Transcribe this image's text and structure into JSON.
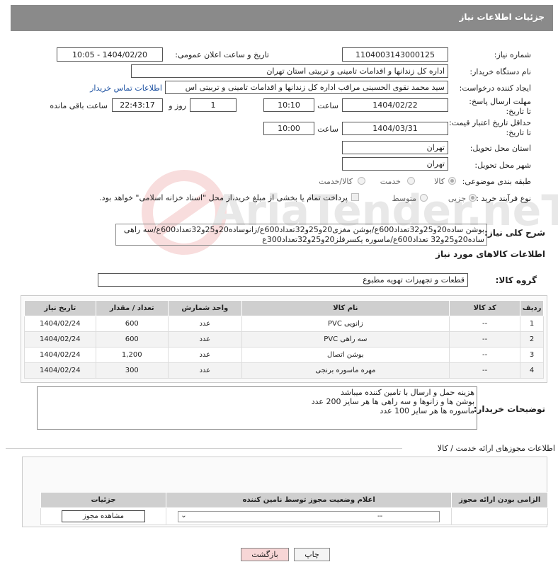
{
  "header": {
    "title": "جزئیات اطلاعات نیاز"
  },
  "fields": {
    "need_number_label": "شماره نیاز:",
    "need_number": "1104003143000125",
    "announce_label": "تاریخ و ساعت اعلان عمومی:",
    "announce_value": "1404/02/20 - 10:05",
    "buyer_org_label": "نام دستگاه خریدار:",
    "buyer_org": "اداره کل زندانها و اقدامات تامینی و تربیتی استان تهران",
    "requester_label": "ایجاد کننده درخواست:",
    "requester": "سید محمد نقوی الحسینی مراقب  اداره کل زندانها و اقدامات تامینی و تربیتی اس",
    "contact_link": "اطلاعات تماس خریدار",
    "deadline_label": "مهلت ارسال پاسخ: تا تاریخ:",
    "deadline_date": "1404/02/22",
    "time_label": "ساعت",
    "deadline_time": "10:10",
    "days_value": "1",
    "days_label": "روز و",
    "remaining_time": "22:43:17",
    "remaining_label": "ساعت باقی مانده",
    "validity_label": "حداقل تاریخ اعتبار قیمت: تا تاریخ:",
    "validity_date": "1404/03/31",
    "validity_time": "10:00",
    "province_label": "استان محل تحویل:",
    "province": "تهران",
    "city_label": "شهر محل تحویل:",
    "city": "تهران",
    "category_label": "طبقه بندی موضوعی:",
    "cat_goods": "کالا",
    "cat_service": "خدمت",
    "cat_both": "کالا/خدمت",
    "process_label": "نوع فرآیند خرید :",
    "proc_partial": "جزیی",
    "proc_medium": "متوسط",
    "payment_note": "پرداخت تمام یا بخشی از مبلغ خرید،از محل \"اسناد خزانه اسلامی\" خواهد بود."
  },
  "description": {
    "label": "شرح کلی نیاز:",
    "text": "بوشن ساده20و25و32تعداد600ع/بوشن مغزی20و25و32تعداد600ع/زانوساده20و25و32تعداد600ع/سه راهی ساده20و25و32 تعداد600ع/ماسوره یکسرفلز20و25و32تعداد300ع"
  },
  "goods_section": {
    "title": "اطلاعات کالاهای مورد نیاز",
    "group_label": "گروه کالا:",
    "group_value": "قطعات و تجهیزات تهویه مطبوع"
  },
  "goods_table": {
    "headers": [
      "ردیف",
      "کد کالا",
      "نام کالا",
      "واحد شمارش",
      "تعداد / مقدار",
      "تاریخ نیاز"
    ],
    "rows": [
      [
        "1",
        "--",
        "زانویی PVC",
        "عدد",
        "600",
        "1404/02/24"
      ],
      [
        "2",
        "--",
        "سه راهی PVC",
        "عدد",
        "600",
        "1404/02/24"
      ],
      [
        "3",
        "--",
        "بوشن اتصال",
        "عدد",
        "1,200",
        "1404/02/24"
      ],
      [
        "4",
        "--",
        "مهره ماسوره برنجی",
        "عدد",
        "300",
        "1404/02/24"
      ]
    ]
  },
  "buyer_notes": {
    "label": "توضیحات خریدار:",
    "lines": [
      "هزینه حمل و ارسال با تامین کننده میباشد",
      "بوشن ها و زانوها و سه راهی ها هر سایز 200 عدد",
      "ماسوره ها هر سایز 100 عدد"
    ]
  },
  "permits": {
    "title": "اطلاعات مجوزهای ارائه خدمت / کالا",
    "headers": [
      "الزامی بودن ارائه مجوز",
      "اعلام وضعیت مجوز توسط نامین کننده",
      "جزئیات"
    ],
    "select_value": "--",
    "view_button": "مشاهده مجوز"
  },
  "buttons": {
    "print": "چاپ",
    "back": "بازگشت"
  },
  "watermark": "AriaTender.neT",
  "colors": {
    "header_bg": "#8a8a8a",
    "link": "#1a4fa0",
    "back_button_bg": "#f7d6d6"
  }
}
